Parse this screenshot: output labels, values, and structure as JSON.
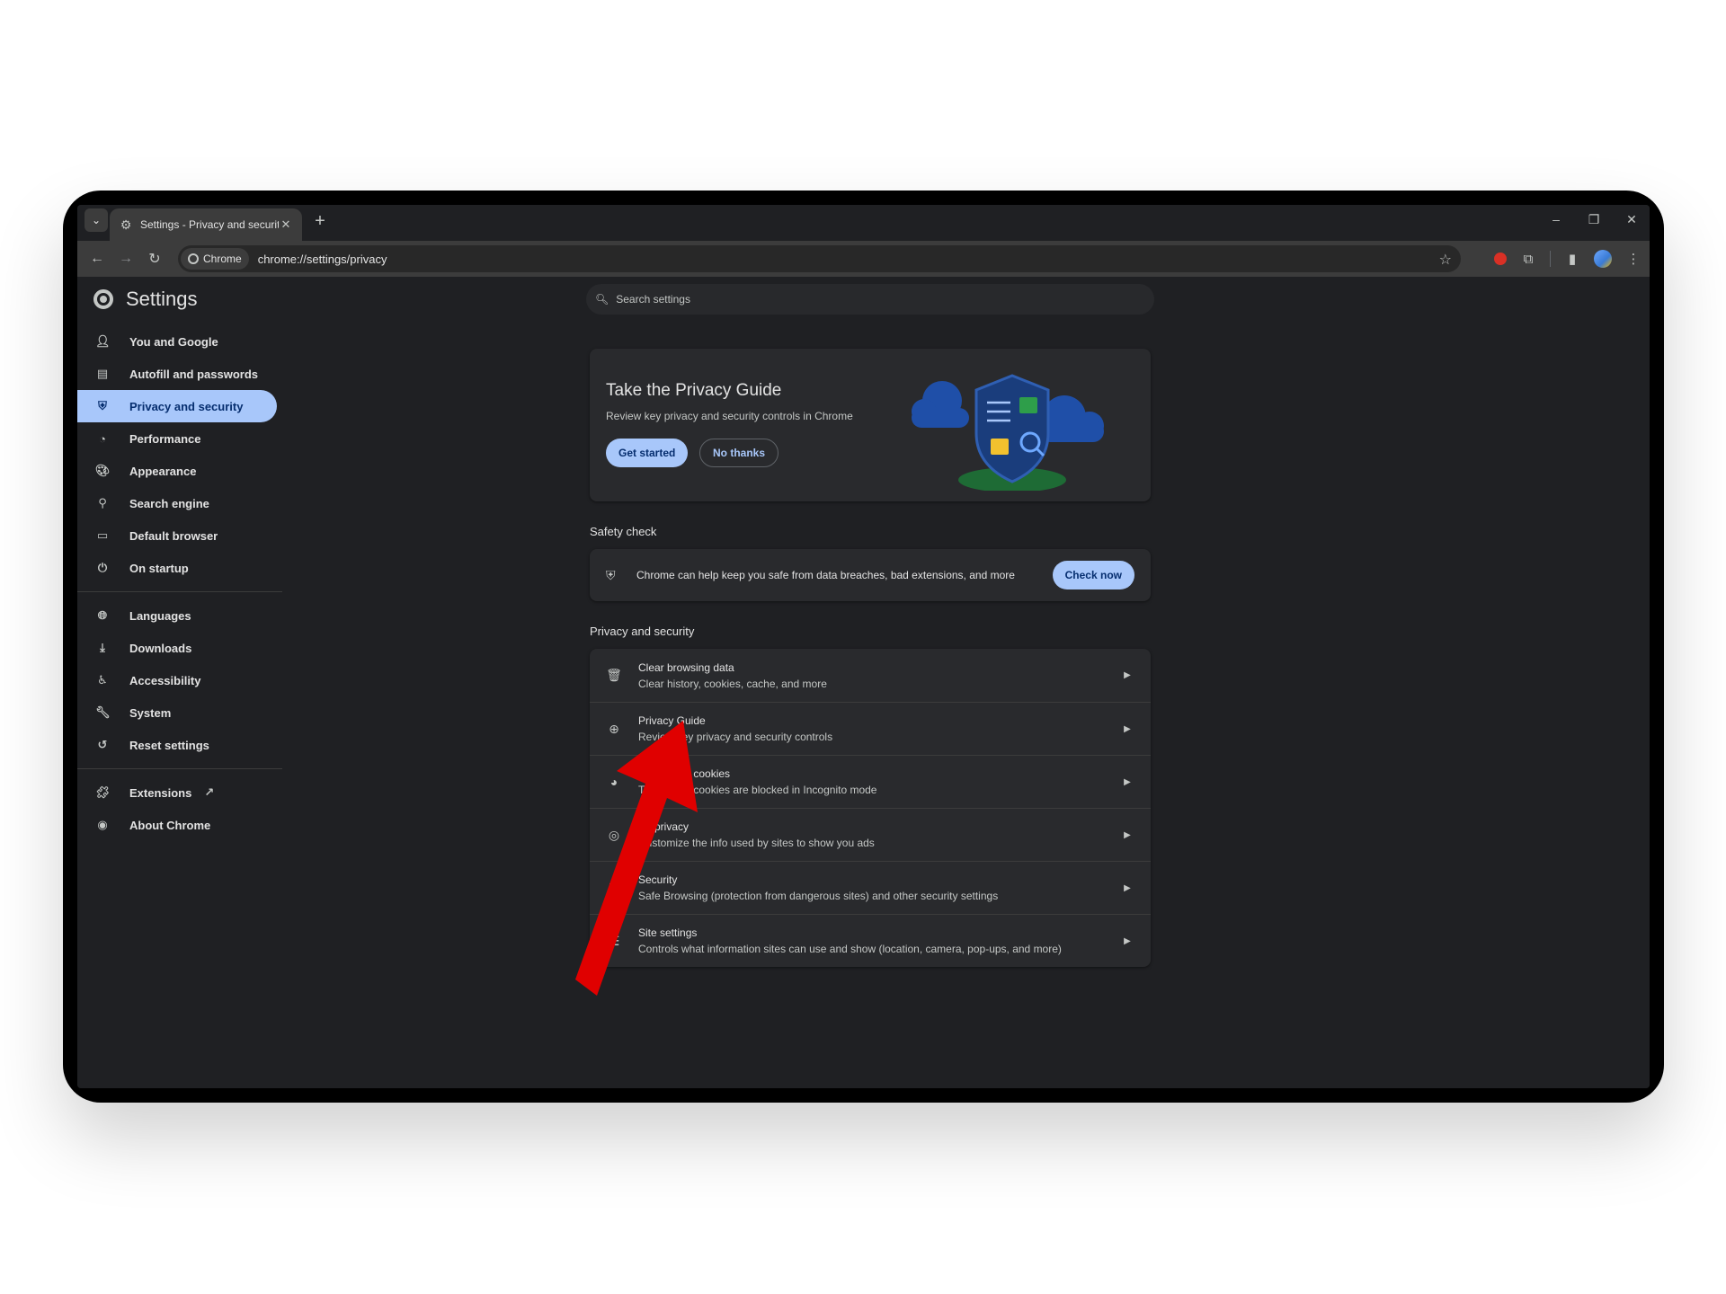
{
  "browser": {
    "tab_title": "Settings - Privacy and security",
    "chip_label": "Chrome",
    "url": "chrome://settings/privacy"
  },
  "settings": {
    "title": "Settings",
    "search_placeholder": "Search settings"
  },
  "sidebar": {
    "items": [
      {
        "label": "You and Google",
        "icon": "person-icon"
      },
      {
        "label": "Autofill and passwords",
        "icon": "clipboard-icon"
      },
      {
        "label": "Privacy and security",
        "icon": "shield-icon"
      },
      {
        "label": "Performance",
        "icon": "speedometer-icon"
      },
      {
        "label": "Appearance",
        "icon": "palette-icon"
      },
      {
        "label": "Search engine",
        "icon": "search-icon"
      },
      {
        "label": "Default browser",
        "icon": "browser-window-icon"
      },
      {
        "label": "On startup",
        "icon": "power-icon"
      },
      {
        "label": "Languages",
        "icon": "globe-icon"
      },
      {
        "label": "Downloads",
        "icon": "download-icon"
      },
      {
        "label": "Accessibility",
        "icon": "accessibility-icon"
      },
      {
        "label": "System",
        "icon": "wrench-icon"
      },
      {
        "label": "Reset settings",
        "icon": "history-icon"
      },
      {
        "label": "Extensions",
        "icon": "puzzle-icon"
      },
      {
        "label": "About Chrome",
        "icon": "chrome-icon"
      }
    ],
    "active_index": 2
  },
  "privacy_guide": {
    "title": "Take the Privacy Guide",
    "description": "Review key privacy and security controls in Chrome",
    "get_started": "Get started",
    "no_thanks": "No thanks"
  },
  "safety_check": {
    "heading": "Safety check",
    "text": "Chrome can help keep you safe from data breaches, bad extensions, and more",
    "button": "Check now"
  },
  "privacy_section": {
    "heading": "Privacy and security",
    "rows": [
      {
        "title": "Clear browsing data",
        "subtitle": "Clear history, cookies, cache, and more",
        "icon": "trash-icon"
      },
      {
        "title": "Privacy Guide",
        "subtitle": "Review key privacy and security controls",
        "icon": "privacy-guide-icon"
      },
      {
        "title": "Third-party cookies",
        "subtitle": "Third-party cookies are blocked in Incognito mode",
        "icon": "cookie-icon"
      },
      {
        "title": "Ad privacy",
        "subtitle": "Customize the info used by sites to show you ads",
        "icon": "ad-privacy-icon"
      },
      {
        "title": "Security",
        "subtitle": "Safe Browsing (protection from dangerous sites) and other security settings",
        "icon": "security-shield-icon"
      },
      {
        "title": "Site settings",
        "subtitle": "Controls what information sites can use and show (location, camera, pop-ups, and more)",
        "icon": "sliders-icon"
      }
    ]
  },
  "colors": {
    "accent": "#a8c7fa",
    "annotation_arrow": "#e00000"
  }
}
